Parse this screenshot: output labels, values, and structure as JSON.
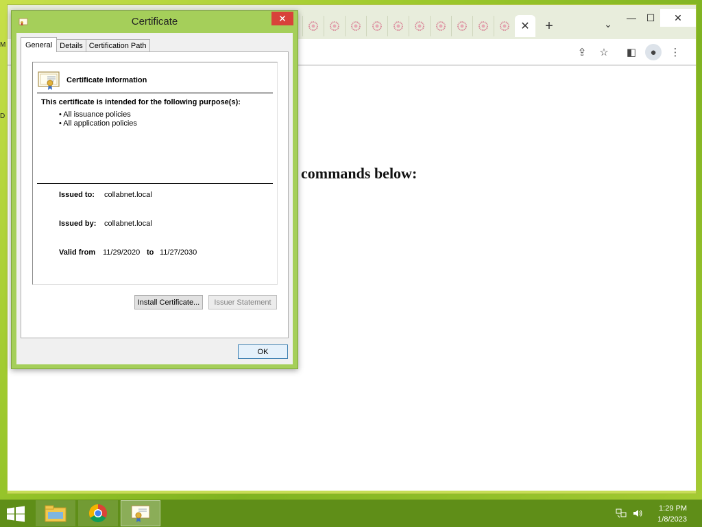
{
  "desktop": {
    "stub_top": "M",
    "stub_mid": "D"
  },
  "browser": {
    "tab_count_icons": 10,
    "tab_close_glyph": "✕",
    "newtab_glyph": "+",
    "tablist_glyph": "⌄",
    "window_controls": {
      "minimize": "—",
      "maximize": "☐",
      "close": "✕"
    },
    "toolbar": {
      "share_glyph": "⇪",
      "bookmark_glyph": "☆",
      "sidepanel_glyph": "◧",
      "profile_glyph": "●",
      "menu_glyph": "⋮"
    },
    "page_heading": "commands below:"
  },
  "dialog": {
    "title": "Certificate",
    "close_glyph": "✕",
    "tabs": [
      "General",
      "Details",
      "Certification Path"
    ],
    "info_title": "Certificate Information",
    "purpose_title": "This certificate is intended for the following purpose(s):",
    "purposes": [
      "• All issuance policies",
      "• All application policies"
    ],
    "issued_to_label": "Issued to:",
    "issued_to_value": "collabnet.local",
    "issued_by_label": "Issued by:",
    "issued_by_value": "collabnet.local",
    "valid_from_label": "Valid from",
    "valid_from_value": "11/29/2020",
    "valid_to_label": "to",
    "valid_to_value": "11/27/2030",
    "install_button": "Install Certificate...",
    "issuer_button": "Issuer Statement",
    "ok_button": "OK"
  },
  "taskbar": {
    "time": "1:29 PM",
    "date": "1/8/2023"
  },
  "colors": {
    "desktop_green": "#9cc82c",
    "taskbar_green": "#5f8e18",
    "dialog_frame": "#a5cf5a",
    "close_red": "#d8423a"
  }
}
